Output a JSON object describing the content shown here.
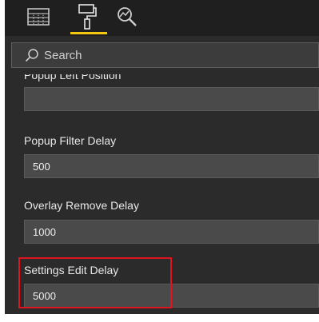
{
  "toolbar": {
    "tabs": [
      {
        "icon": "fields-grid-icon",
        "active": false
      },
      {
        "icon": "format-paint-roller-icon",
        "active": true
      },
      {
        "icon": "analytics-magnifier-icon",
        "active": false
      }
    ],
    "accent_color": "#f2c811"
  },
  "search": {
    "placeholder": "Search"
  },
  "settings": [
    {
      "label": "Popup Left Position",
      "value": ""
    },
    {
      "label": "Popup Filter Delay",
      "value": "500"
    },
    {
      "label": "Overlay Remove Delay",
      "value": "1000"
    },
    {
      "label": "Settings Edit Delay",
      "value": "5000",
      "highlighted": true
    }
  ],
  "colors": {
    "panel_background": "#2b2b2b",
    "input_background": "#4a4a4a",
    "highlight_border": "#e0141e"
  }
}
